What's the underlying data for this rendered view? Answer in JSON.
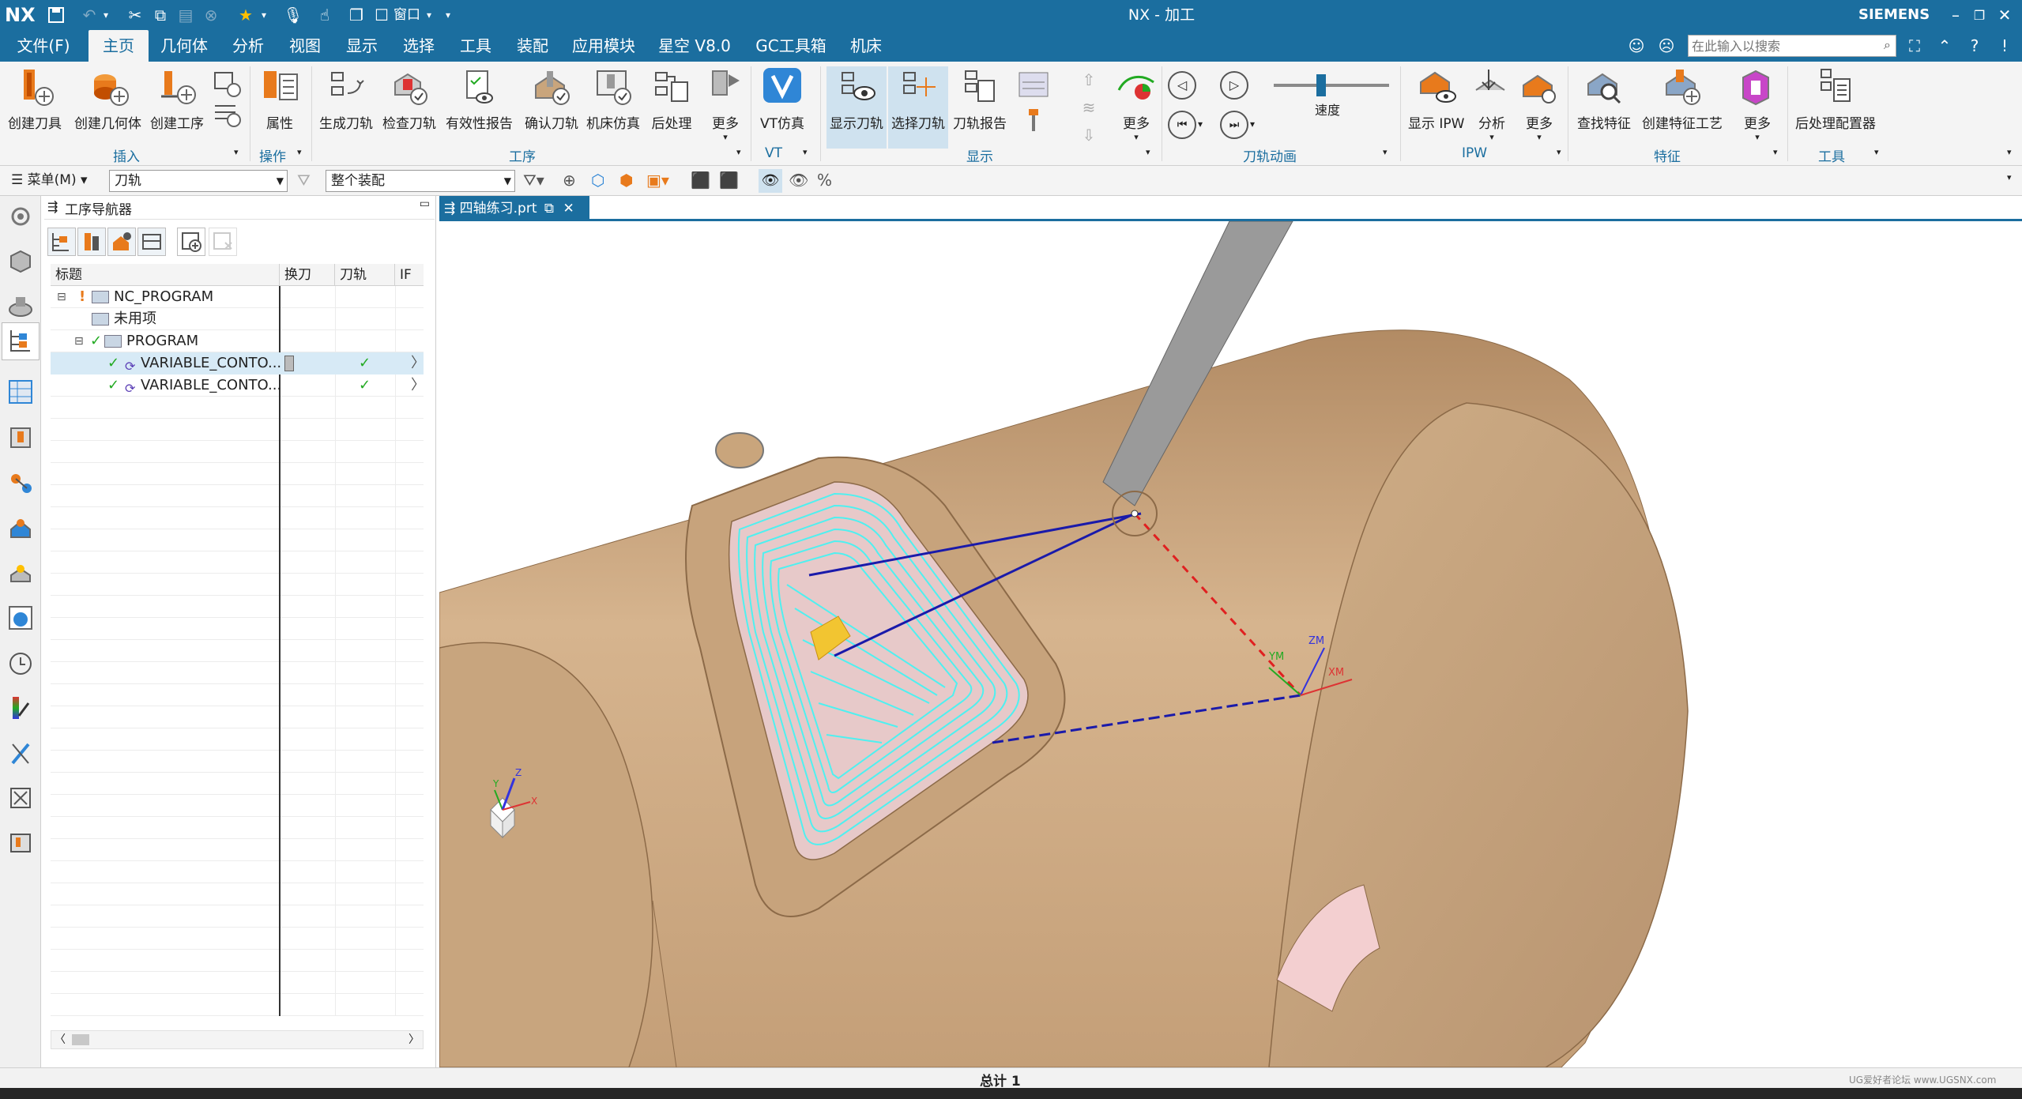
{
  "titlebar": {
    "logo": "NX",
    "window_menu": "窗口",
    "title": "NX - 加工",
    "brand": "SIEMENS"
  },
  "menubar": {
    "items": [
      "文件(F)",
      "主页",
      "几何体",
      "分析",
      "视图",
      "显示",
      "选择",
      "工具",
      "装配",
      "应用模块",
      "星空 V8.0",
      "GC工具箱",
      "机床"
    ],
    "active": "主页",
    "search_placeholder": "在此输入以搜索"
  },
  "ribbon": {
    "buttons": [
      "创建刀具",
      "创建几何体",
      "创建工序",
      "属性",
      "生成刀轨",
      "检查刀轨",
      "有效性报告",
      "确认刀轨",
      "机床仿真",
      "后处理",
      "更多",
      "VT仿真",
      "显示刀轨",
      "选择刀轨",
      "刀轨报告",
      "更多",
      "速度",
      "显示 IPW",
      "分析",
      "更多",
      "查找特征",
      "创建特征工艺",
      "更多",
      "后处理配置器"
    ],
    "groups": [
      "插入",
      "操作",
      "工序",
      "VT",
      "显示",
      "刀轨动画",
      "IPW",
      "特征",
      "工具"
    ]
  },
  "selectionbar": {
    "menu_label": "菜单(M)",
    "type_filter": "刀轨",
    "scope_filter": "整个装配"
  },
  "navigator": {
    "title": "工序导航器",
    "columns": [
      "标题",
      "换刀",
      "刀轨",
      "IF"
    ],
    "rows": [
      {
        "name": "NC_PROGRAM",
        "status": "!",
        "toolchange": "",
        "toolpath": ""
      },
      {
        "name": "未用项",
        "status": "",
        "toolchange": "",
        "toolpath": ""
      },
      {
        "name": "PROGRAM",
        "status": "✓",
        "toolchange": "",
        "toolpath": ""
      },
      {
        "name": "VARIABLE_CONTO...",
        "status": "✓",
        "toolchange": "",
        "toolpath": "✓"
      },
      {
        "name": "VARIABLE_CONTO...",
        "status": "✓",
        "toolchange": "",
        "toolpath": "✓"
      }
    ]
  },
  "viewport": {
    "tab_label": "四轴练习.prt",
    "axis_labels": [
      "YM",
      "ZM",
      "XM"
    ],
    "triad_labels": [
      "X",
      "Y",
      "Z"
    ]
  },
  "statusbar": {
    "total": "总计 1",
    "watermark": "UG爱好者论坛 www.UGSNX.com"
  },
  "colors": {
    "title_blue": "#1b6e9f",
    "part_tan": "#c9a57c",
    "toolpath_cyan": "#4ff0f0",
    "check_green": "#22aa22"
  }
}
